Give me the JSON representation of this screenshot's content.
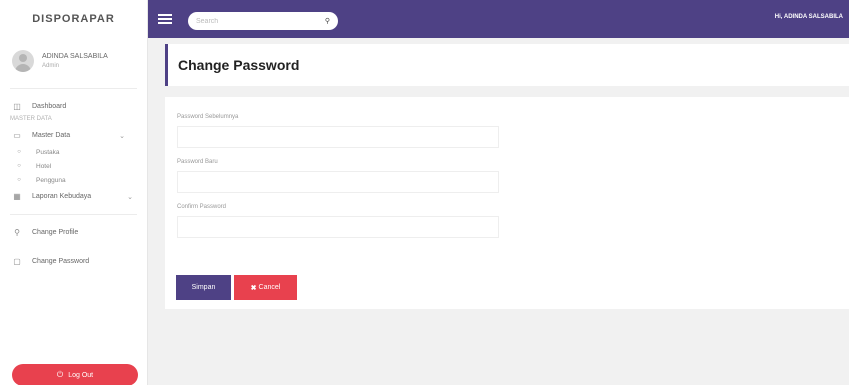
{
  "brand": "DISPORAPAR",
  "user": {
    "name": "ADINDA SALSABILA",
    "status": "Admin"
  },
  "sidebar": {
    "section_1": "—————",
    "dashboard": {
      "label": "Dashboard",
      "icon": "dashboard-icon"
    },
    "section_2": "MASTER DATA",
    "master_data": {
      "label": "Master Data",
      "icon": "folder-icon"
    },
    "sub_items": [
      {
        "label": "Pustaka"
      },
      {
        "label": "Hotel"
      },
      {
        "label": "Pengguna"
      }
    ],
    "laporan": {
      "label": "Laporan Kebudaya",
      "icon": "report-icon"
    },
    "section_3": "—————",
    "change_profile": {
      "label": "Change Profile",
      "icon": "user-icon"
    },
    "change_password": {
      "label": "Change Password",
      "icon": "lock-icon"
    },
    "logout": {
      "label": "Log Out",
      "icon": "power-icon"
    }
  },
  "navbar": {
    "search_placeholder": "Search",
    "user_greeting": "Hi, ADINDA SALSABILA"
  },
  "page": {
    "title": "Change Password"
  },
  "form": {
    "fields": [
      {
        "label": "Password Sebelumnya",
        "value": ""
      },
      {
        "label": "Password Baru",
        "value": ""
      },
      {
        "label": "Confirm Password",
        "value": ""
      }
    ],
    "submit_label": "Simpan",
    "cancel_label": "Cancel"
  },
  "colors": {
    "accent": "#4e4185",
    "danger": "#e8414e"
  }
}
